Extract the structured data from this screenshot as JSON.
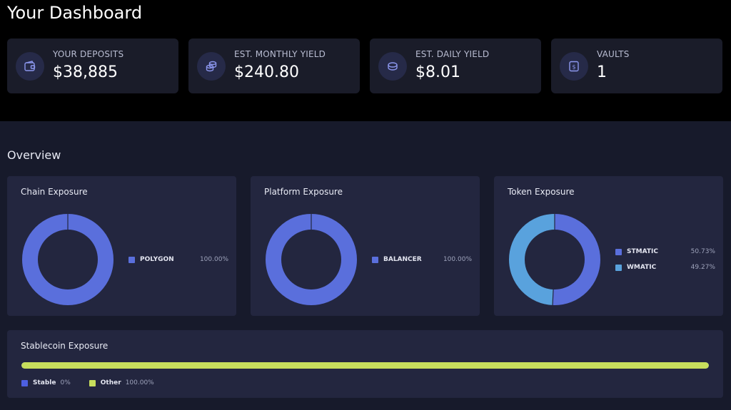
{
  "header": {
    "title": "Your Dashboard"
  },
  "stats": [
    {
      "label": "YOUR DEPOSITS",
      "value": "$38,885",
      "icon": "wallet-icon"
    },
    {
      "label": "EST. MONTHLY YIELD",
      "value": "$240.80",
      "icon": "coins-stack-icon"
    },
    {
      "label": "EST. DAILY YIELD",
      "value": "$8.01",
      "icon": "coin-icon"
    },
    {
      "label": "VAULTS",
      "value": "1",
      "icon": "vault-icon"
    }
  ],
  "overview": {
    "title": "Overview",
    "cards": [
      {
        "title": "Chain Exposure",
        "items": [
          {
            "name": "POLYGON",
            "pct": "100.00%",
            "value": 100.0,
            "color": "#5a6fdc"
          }
        ]
      },
      {
        "title": "Platform Exposure",
        "items": [
          {
            "name": "BALANCER",
            "pct": "100.00%",
            "value": 100.0,
            "color": "#5a6fdc"
          }
        ]
      },
      {
        "title": "Token Exposure",
        "items": [
          {
            "name": "STMATIC",
            "pct": "50.73%",
            "value": 50.73,
            "color": "#5a6fdc"
          },
          {
            "name": "WMATIC",
            "pct": "49.27%",
            "value": 49.27,
            "color": "#59a2dd"
          }
        ]
      }
    ]
  },
  "stablecoin": {
    "title": "Stablecoin Exposure",
    "stable_label": "Stable",
    "stable_value": "0%",
    "stable_fraction": 0,
    "other_label": "Other",
    "other_value": "100.00%",
    "other_fraction": 1,
    "stable_color": "#4d5fe0",
    "other_color": "#c7de5c"
  },
  "colors": {
    "background": "#000000",
    "card": "#1a1c29",
    "panel": "#171a2b",
    "exposure_card": "#23263f",
    "accent": "#5a6fdc"
  }
}
